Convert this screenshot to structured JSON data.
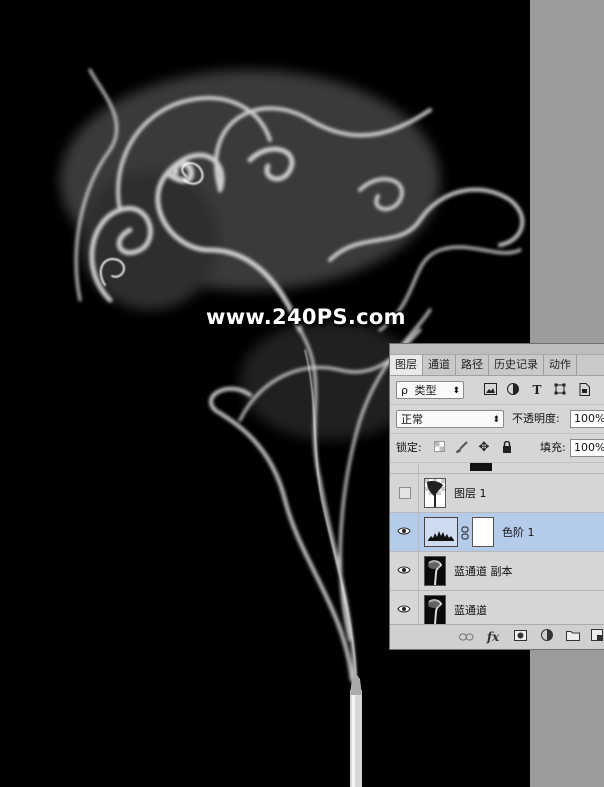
{
  "watermark": "www.240PS.com",
  "panel": {
    "tabs": [
      "图层",
      "通道",
      "路径",
      "历史记录",
      "动作"
    ],
    "active_tab": "图层",
    "filter": {
      "search_glyph": "ρ",
      "kind_label": "类型"
    },
    "blend_mode": "正常",
    "opacity": {
      "label": "不透明度:",
      "value": "100%"
    },
    "lock": {
      "label": "锁定:"
    },
    "fill": {
      "label": "填充:",
      "value": "100%"
    },
    "layers": [
      {
        "name": "图层 1",
        "visible": false,
        "selected": false,
        "kind": "pixel-with-transparency"
      },
      {
        "name": "色阶 1",
        "visible": true,
        "selected": true,
        "kind": "levels-adjustment"
      },
      {
        "name": "蓝通道 副本",
        "visible": true,
        "selected": false,
        "kind": "pixel"
      },
      {
        "name": "蓝通道",
        "visible": true,
        "selected": false,
        "kind": "pixel"
      }
    ],
    "colors": {
      "selected_row": "#b5cbea",
      "panel_bg": "#d6d6d6"
    }
  }
}
